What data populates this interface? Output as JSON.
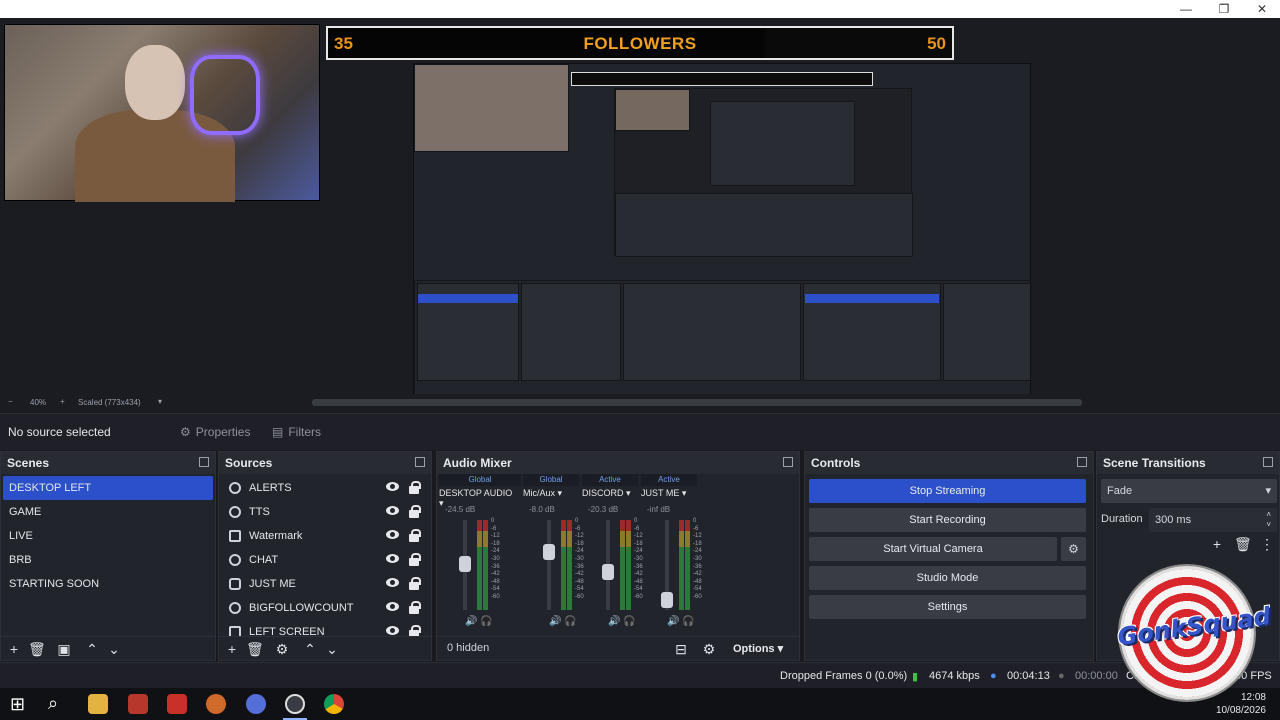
{
  "window": {
    "minimize": "—",
    "maximize": "❐",
    "close": "✕"
  },
  "overlay": {
    "followers_current": "35",
    "followers_label": "FOLLOWERS",
    "followers_goal": "50",
    "progress": 0.7
  },
  "preview": {
    "zoom": "40%",
    "scale": "Scaled (773x434)"
  },
  "source_bar": {
    "status": "No source selected",
    "properties": "Properties",
    "filters": "Filters"
  },
  "scenes": {
    "title": "Scenes",
    "items": [
      "DESKTOP LEFT",
      "GAME",
      "LIVE",
      "BRB",
      "STARTING SOON"
    ]
  },
  "sources": {
    "title": "Sources",
    "items": [
      "ALERTS",
      "TTS",
      "Watermark",
      "CHAT",
      "JUST ME",
      "BIGFOLLOWCOUNT",
      "LEFT SCREEN"
    ]
  },
  "mixer": {
    "title": "Audio Mixer",
    "channels": [
      {
        "tag": "Global",
        "name": "DESKTOP AUDIO",
        "db": "-24.5 dB",
        "level": 0.55
      },
      {
        "tag": "Global",
        "name": "Mic/Aux",
        "db": "-8.0 dB",
        "level": 0.7
      },
      {
        "tag": "Active",
        "name": "DISCORD",
        "db": "-20.3 dB",
        "level": 0.45
      },
      {
        "tag": "Active",
        "name": "JUST ME",
        "db": "-inf dB",
        "level": 0.1
      }
    ],
    "scale": [
      "0",
      "-6",
      "-12",
      "-18",
      "-24",
      "-30",
      "-36",
      "-42",
      "-48",
      "-54",
      "-60"
    ],
    "hidden": "0 hidden",
    "options": "Options"
  },
  "controls": {
    "title": "Controls",
    "stop_streaming": "Stop Streaming",
    "start_recording": "Start Recording",
    "start_virtual_camera": "Start Virtual Camera",
    "studio_mode": "Studio Mode",
    "settings": "Settings"
  },
  "transitions": {
    "title": "Scene Transitions",
    "selected": "Fade",
    "duration_label": "Duration",
    "duration_value": "300 ms"
  },
  "status": {
    "dropped": "Dropped Frames 0 (0.0%)",
    "bitrate": "4674 kbps",
    "live_time": "00:04:13",
    "rec_time": "00:00:00",
    "cpu": "CP",
    "fps": ".00 FPS"
  },
  "taskbar": {
    "time": "12:08",
    "date": "10/08/2026"
  },
  "logo": {
    "text": "GonkSquad"
  },
  "colors": {
    "accent": "#2c50c9",
    "panel": "#22242b",
    "meter_green": "#2c7a3a"
  }
}
